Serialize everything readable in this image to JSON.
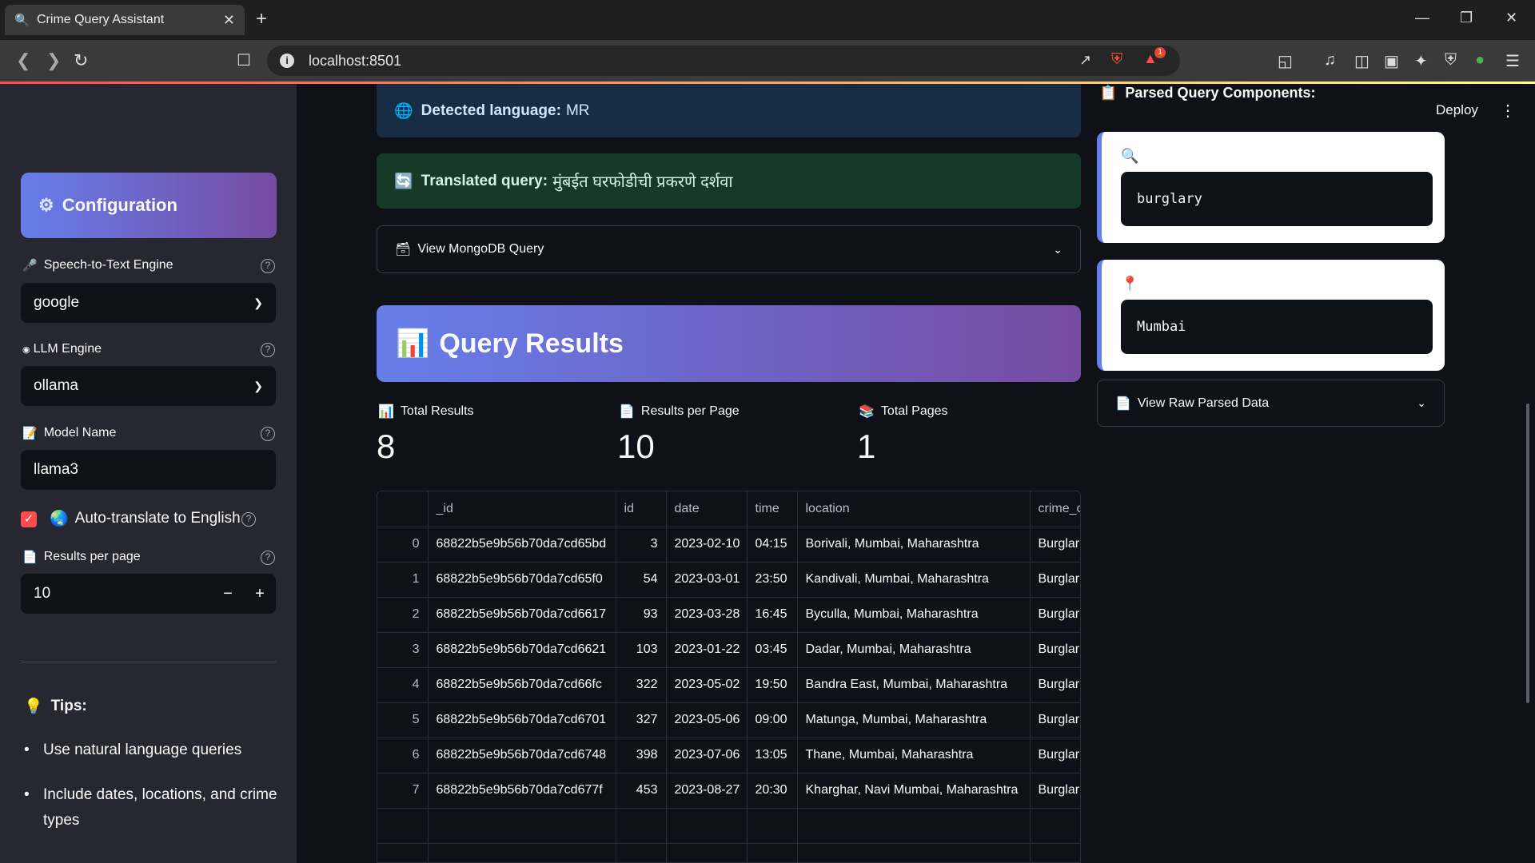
{
  "browser": {
    "tab_title": "Crime Query Assistant",
    "tab_icon": "search-icon",
    "url": "localhost:8501",
    "brave_badge": "1"
  },
  "sidebar": {
    "config_title": "Configuration",
    "stt_label": "Speech-to-Text Engine",
    "stt_value": "google",
    "llm_label": "LLM Engine",
    "llm_value": "ollama",
    "model_label": "Model Name",
    "model_value": "llama3",
    "translate_label": "Auto-translate to English",
    "rpp_label": "Results per page",
    "rpp_value": "10",
    "tips_title": "Tips:",
    "tips": [
      "Use natural language queries",
      "Include dates, locations, and crime types"
    ]
  },
  "main": {
    "detected_label": "Detected language:",
    "detected_value": "MR",
    "translated_label": "Translated query:",
    "translated_value": "मुंबईत घरफोडीची प्रकरणे दर्शवा",
    "mongo_expander": "View MongoDB Query",
    "results_title": "Query Results",
    "metrics": [
      {
        "label": "Total Results",
        "value": "8"
      },
      {
        "label": "Results per Page",
        "value": "10"
      },
      {
        "label": "Total Pages",
        "value": "1"
      }
    ],
    "table": {
      "columns": [
        "",
        "_id",
        "id",
        "date",
        "time",
        "location",
        "crime_c"
      ],
      "rows": [
        [
          "0",
          "68822b5e9b56b70da7cd65bd",
          "3",
          "2023-02-10",
          "04:15",
          "Borivali, Mumbai, Maharashtra",
          "Burglar"
        ],
        [
          "1",
          "68822b5e9b56b70da7cd65f0",
          "54",
          "2023-03-01",
          "23:50",
          "Kandivali, Mumbai, Maharashtra",
          "Burglar"
        ],
        [
          "2",
          "68822b5e9b56b70da7cd6617",
          "93",
          "2023-03-28",
          "16:45",
          "Byculla, Mumbai, Maharashtra",
          "Burglar"
        ],
        [
          "3",
          "68822b5e9b56b70da7cd6621",
          "103",
          "2023-01-22",
          "03:45",
          "Dadar, Mumbai, Maharashtra",
          "Burglar"
        ],
        [
          "4",
          "68822b5e9b56b70da7cd66fc",
          "322",
          "2023-05-02",
          "19:50",
          "Bandra East, Mumbai, Maharashtra",
          "Burglar"
        ],
        [
          "5",
          "68822b5e9b56b70da7cd6701",
          "327",
          "2023-05-06",
          "09:00",
          "Matunga, Mumbai, Maharashtra",
          "Burglar"
        ],
        [
          "6",
          "68822b5e9b56b70da7cd6748",
          "398",
          "2023-07-06",
          "13:05",
          "Thane, Mumbai, Maharashtra",
          "Burglar"
        ],
        [
          "7",
          "68822b5e9b56b70da7cd677f",
          "453",
          "2023-08-27",
          "20:30",
          "Kharghar, Navi Mumbai, Maharashtra",
          "Burglar"
        ]
      ]
    }
  },
  "right": {
    "title": "Parsed Query Components:",
    "deploy": "Deploy",
    "crime_type": "burglary",
    "location": "Mumbai",
    "raw_expander": "View Raw Parsed Data"
  },
  "colors": {
    "accent": "#ff4b4b",
    "gradient_start": "#667eea",
    "gradient_end": "#764ba2",
    "info_bg": "#172d43",
    "success_bg": "#173928"
  }
}
